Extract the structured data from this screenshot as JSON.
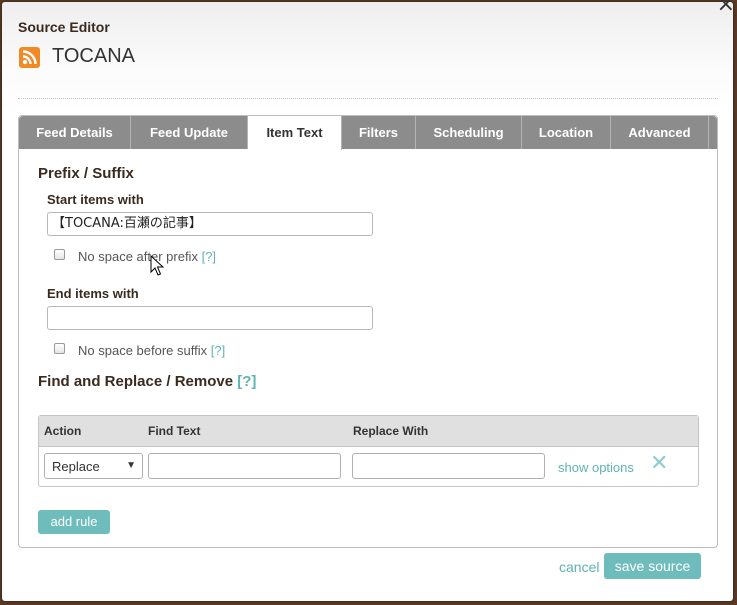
{
  "dialog": {
    "title": "Source Editor",
    "feed_name": "TOCANA",
    "close": "×"
  },
  "tabs": [
    {
      "label": "Feed Details"
    },
    {
      "label": "Feed Update"
    },
    {
      "label": "Item Text",
      "active": true
    },
    {
      "label": "Filters"
    },
    {
      "label": "Scheduling"
    },
    {
      "label": "Location"
    },
    {
      "label": "Advanced"
    }
  ],
  "prefix_suffix": {
    "title": "Prefix / Suffix",
    "start_label": "Start items with",
    "start_value": "【TOCANA:百瀬の記事】",
    "no_space_prefix_label": "No space after prefix",
    "no_space_prefix_checked": false,
    "end_label": "End items with",
    "end_value": "",
    "no_space_suffix_label": "No space before suffix",
    "no_space_suffix_checked": false,
    "help": "[?]"
  },
  "find_replace": {
    "title": "Find and Replace / Remove",
    "help": "[?]",
    "columns": [
      "Action",
      "Find Text",
      "Replace With"
    ],
    "rule": {
      "action": "Replace",
      "find": "",
      "replace": "",
      "show_options": "show options"
    },
    "add_rule": "add rule"
  },
  "footer": {
    "cancel": "cancel",
    "save": "save source"
  },
  "colors": {
    "accent": "#6fbcbc",
    "tabbar": "#8c8c8c",
    "rss": "#f08a24"
  }
}
